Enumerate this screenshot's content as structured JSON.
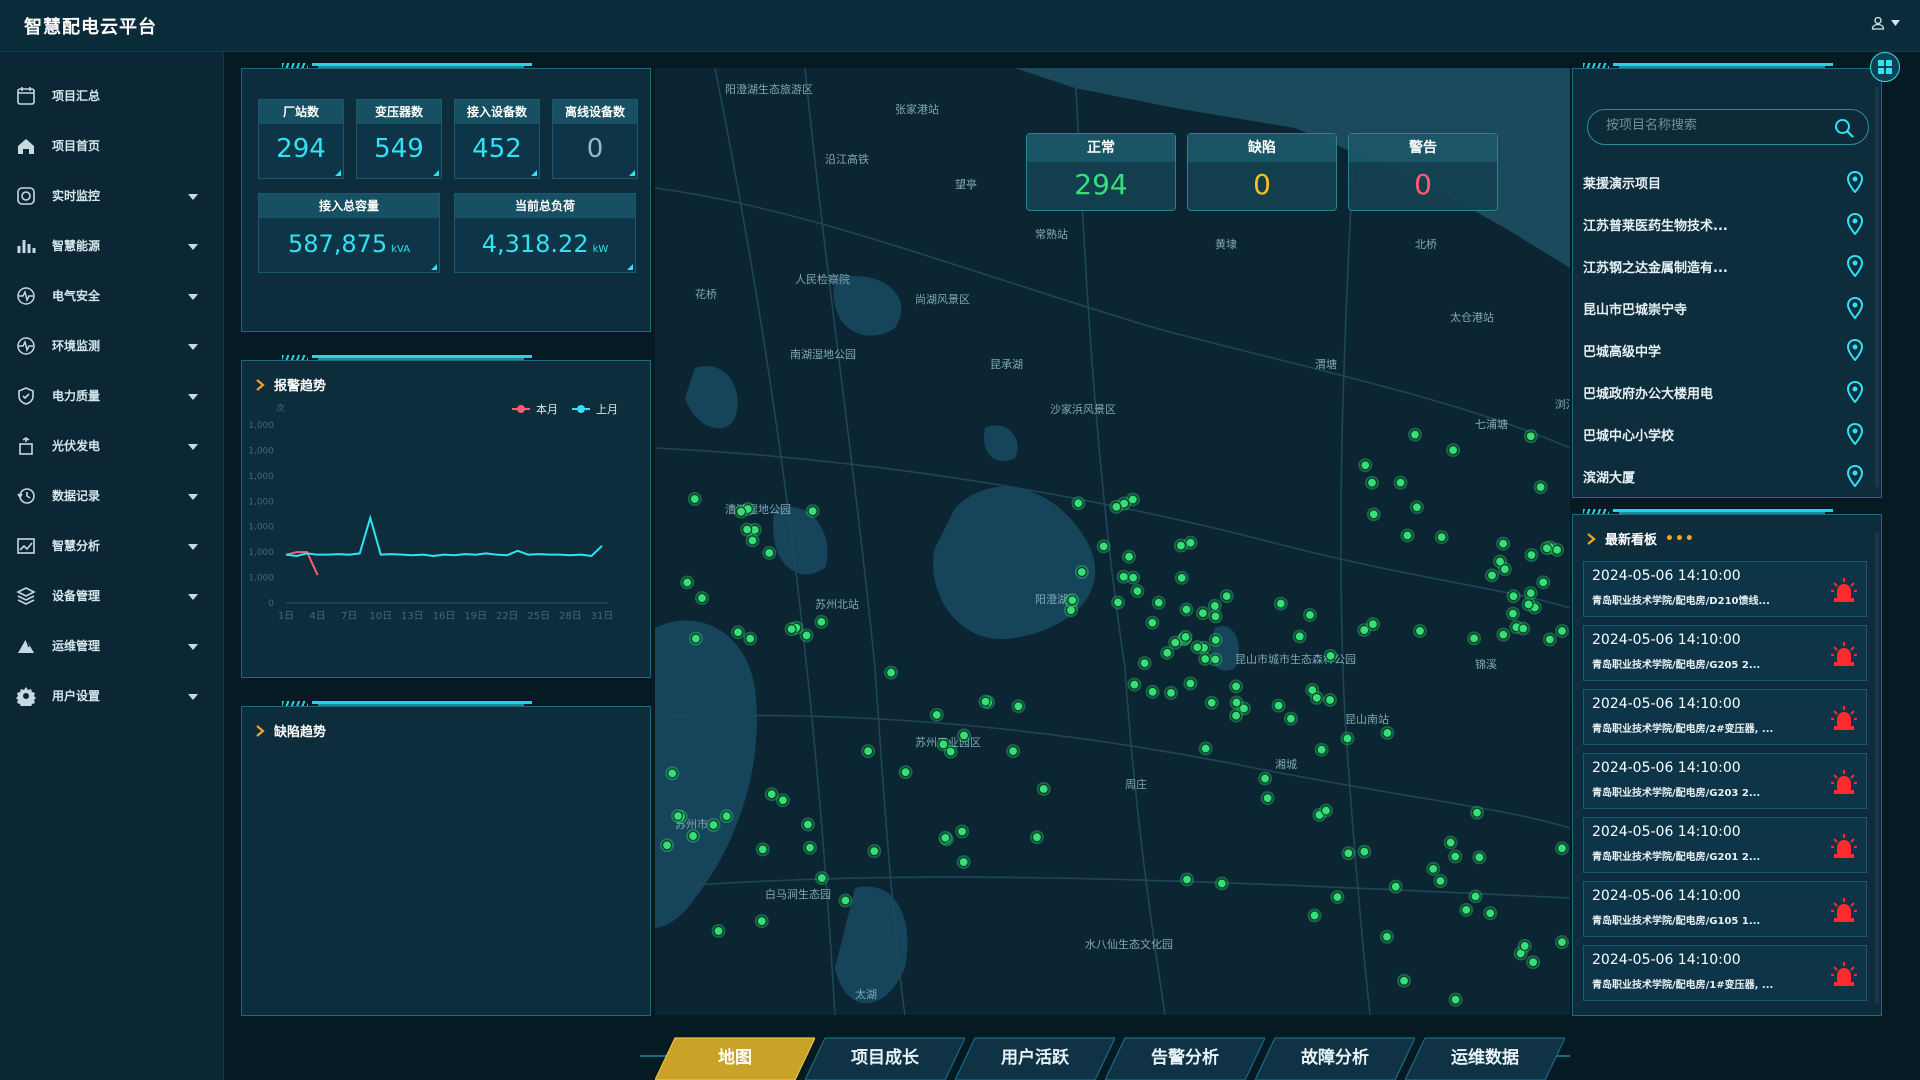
{
  "app": {
    "title": "智慧配电云平台"
  },
  "colors": {
    "accent": "#2fe3f2",
    "normal": "#35e07a",
    "defect": "#f3c21e",
    "warning": "#ff5b73",
    "alarm": "#ff2a2a",
    "tab_active": "#c9a227"
  },
  "sidebar": {
    "items": [
      {
        "label": "项目汇总",
        "icon": "calendar-icon",
        "expandable": false
      },
      {
        "label": "项目首页",
        "icon": "home-icon",
        "expandable": false
      },
      {
        "label": "实时监控",
        "icon": "camera-icon",
        "expandable": true
      },
      {
        "label": "智慧能源",
        "icon": "bar-chart-icon",
        "expandable": true
      },
      {
        "label": "电气安全",
        "icon": "pulse-icon",
        "expandable": true
      },
      {
        "label": "环境监测",
        "icon": "pulse-icon",
        "expandable": true
      },
      {
        "label": "电力质量",
        "icon": "shield-icon",
        "expandable": true
      },
      {
        "label": "光伏发电",
        "icon": "solar-icon",
        "expandable": true
      },
      {
        "label": "数据记录",
        "icon": "history-icon",
        "expandable": true
      },
      {
        "label": "智慧分析",
        "icon": "trend-icon",
        "expandable": true
      },
      {
        "label": "设备管理",
        "icon": "layers-icon",
        "expandable": true
      },
      {
        "label": "运维管理",
        "icon": "pie-icon",
        "expandable": true
      },
      {
        "label": "用户设置",
        "icon": "gear-icon",
        "expandable": true
      }
    ]
  },
  "stats": {
    "stations": {
      "label": "厂站数",
      "value": "294"
    },
    "transformers": {
      "label": "变压器数",
      "value": "549"
    },
    "devices": {
      "label": "接入设备数",
      "value": "452"
    },
    "offline": {
      "label": "离线设备数",
      "value": "0"
    },
    "capacity": {
      "label": "接入总容量",
      "value": "587,875",
      "unit": "kVA"
    },
    "load": {
      "label": "当前总负荷",
      "value": "4,318.22",
      "unit": "kW"
    }
  },
  "status": {
    "normal": {
      "label": "正常",
      "value": "294"
    },
    "defect": {
      "label": "缺陷",
      "value": "0"
    },
    "warning": {
      "label": "警告",
      "value": "0"
    }
  },
  "alarm_trend": {
    "title": "报警趋势",
    "chart_data": {
      "type": "line",
      "ylabel": "次",
      "y_ticks": [
        "0",
        "1,000",
        "1,000",
        "1,000",
        "1,000",
        "1,000",
        "1,000",
        "1,000"
      ],
      "x_ticks": [
        "1日",
        "4日",
        "7日",
        "10日",
        "13日",
        "16日",
        "19日",
        "22日",
        "25日",
        "28日",
        "31日"
      ],
      "legend_position": "top-right",
      "series": [
        {
          "name": "本月",
          "color": "#ff5b73",
          "points": [
            [
              1,
              1.9
            ],
            [
              2,
              2.0
            ],
            [
              3,
              2.0
            ],
            [
              4,
              1.1
            ]
          ]
        },
        {
          "name": "上月",
          "color": "#2fe3f2",
          "points": [
            [
              1,
              1.9
            ],
            [
              2,
              1.85
            ],
            [
              3,
              1.95
            ],
            [
              4,
              1.9
            ],
            [
              5,
              1.9
            ],
            [
              6,
              1.92
            ],
            [
              7,
              1.9
            ],
            [
              8,
              1.95
            ],
            [
              9,
              3.35
            ],
            [
              10,
              1.9
            ],
            [
              11,
              1.92
            ],
            [
              12,
              1.9
            ],
            [
              13,
              1.88
            ],
            [
              14,
              1.9
            ],
            [
              15,
              1.85
            ],
            [
              16,
              1.9
            ],
            [
              17,
              1.88
            ],
            [
              18,
              1.92
            ],
            [
              19,
              1.9
            ],
            [
              20,
              1.95
            ],
            [
              21,
              1.9
            ],
            [
              22,
              1.88
            ],
            [
              23,
              2.05
            ],
            [
              24,
              1.9
            ],
            [
              25,
              1.92
            ],
            [
              26,
              1.9
            ],
            [
              27,
              1.9
            ],
            [
              28,
              1.88
            ],
            [
              29,
              1.9
            ],
            [
              30,
              1.85
            ],
            [
              31,
              2.25
            ]
          ]
        }
      ]
    }
  },
  "defect_trend": {
    "title": "缺陷趋势"
  },
  "search": {
    "placeholder": "按项目名称搜索"
  },
  "projects": [
    "莱援演示项目",
    "江苏普莱医药生物技术...",
    "江苏钢之达金属制造有...",
    "昆山市巴城崇宁寺",
    "巴城高级中学",
    "巴城政府办公大楼用电",
    "巴城中心小学校",
    "滨湖大厦"
  ],
  "board": {
    "title": "最新看板",
    "items": [
      {
        "time": "2024-05-06 14:10:00",
        "path": "青岛职业技术学院/配电房/D210馈线..."
      },
      {
        "time": "2024-05-06 14:10:00",
        "path": "青岛职业技术学院/配电房/G205 2..."
      },
      {
        "time": "2024-05-06 14:10:00",
        "path": "青岛职业技术学院/配电房/2#变压器, ..."
      },
      {
        "time": "2024-05-06 14:10:00",
        "path": "青岛职业技术学院/配电房/G203 2..."
      },
      {
        "time": "2024-05-06 14:10:00",
        "path": "青岛职业技术学院/配电房/G201 2..."
      },
      {
        "time": "2024-05-06 14:10:00",
        "path": "青岛职业技术学院/配电房/G105 1..."
      },
      {
        "time": "2024-05-06 14:10:00",
        "path": "青岛职业技术学院/配电房/1#变压器, ..."
      }
    ]
  },
  "tabs": [
    {
      "label": "地图",
      "active": true
    },
    {
      "label": "项目成长",
      "active": false
    },
    {
      "label": "用户活跃",
      "active": false
    },
    {
      "label": "告警分析",
      "active": false
    },
    {
      "label": "故障分析",
      "active": false
    },
    {
      "label": "运维数据",
      "active": false
    }
  ],
  "map": {
    "labels": [
      "阳澄湖生态旅游区",
      "张家港站",
      "沿江高铁",
      "常熟站",
      "人民检察院",
      "尚湖风景区",
      "南湖湿地公园",
      "昆承湖",
      "沙家浜风景区",
      "太仓港站",
      "漕湖湿地公园",
      "苏州北站",
      "阳澄湖",
      "昆山市城市生态森林公园",
      "昆山南站",
      "苏州工业园区",
      "苏州市",
      "白马涧生态园",
      "太湖",
      "水八仙生态文化园",
      "七浦塘",
      "浏河",
      "花桥",
      "望亭",
      "黄埭",
      "北桥",
      "渭塘",
      "湘城",
      "周庄",
      "锦溪"
    ],
    "markers": 170
  }
}
